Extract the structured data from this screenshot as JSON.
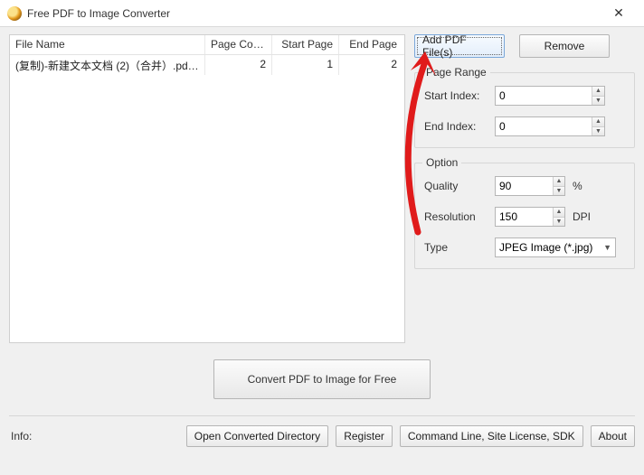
{
  "window": {
    "title": "Free PDF to Image Converter"
  },
  "table": {
    "headers": {
      "file": "File Name",
      "page_count": "Page Count",
      "start": "Start Page",
      "end": "End Page"
    },
    "rows": [
      {
        "file": "(复制)-新建文本文档 (2)（合并）.pdf-...",
        "page_count": "2",
        "start": "1",
        "end": "2"
      }
    ]
  },
  "buttons": {
    "add": "Add PDF File(s)",
    "remove": "Remove",
    "convert": "Convert PDF to Image for Free",
    "open_dir": "Open Converted Directory",
    "register": "Register",
    "cmdline": "Command Line, Site License, SDK",
    "about": "About"
  },
  "page_range": {
    "title": "Page Range",
    "start_label": "Start Index:",
    "start_value": "0",
    "end_label": "End Index:",
    "end_value": "0"
  },
  "option": {
    "title": "Option",
    "quality_label": "Quality",
    "quality_value": "90",
    "quality_unit": "%",
    "resolution_label": "Resolution",
    "resolution_value": "150",
    "resolution_unit": "DPI",
    "type_label": "Type",
    "type_value": "JPEG Image (*.jpg)"
  },
  "footer": {
    "info_label": "Info:"
  }
}
